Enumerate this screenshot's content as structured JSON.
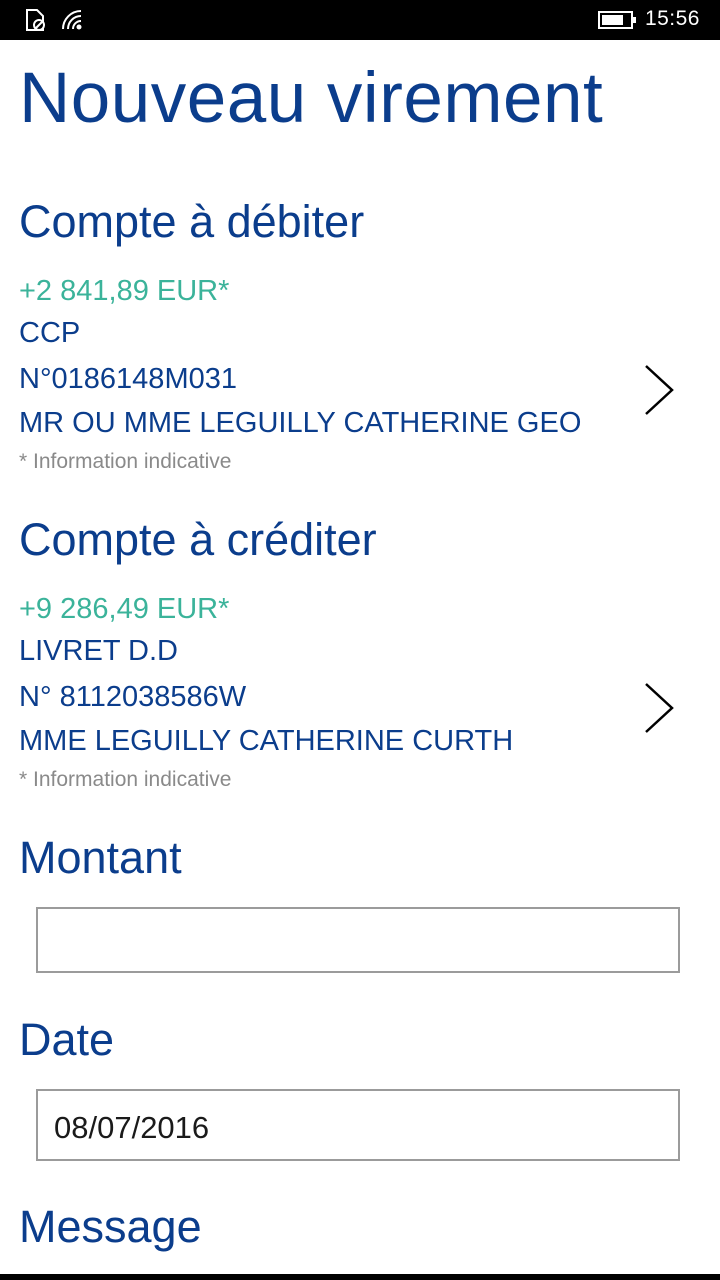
{
  "status_bar": {
    "time": "15:56",
    "icons": [
      "sim-icon",
      "wifi-icon",
      "battery-icon"
    ]
  },
  "page": {
    "title": "Nouveau virement"
  },
  "debit": {
    "heading": "Compte à débiter",
    "balance": "+2 841,89 EUR*",
    "type": "CCP",
    "number": "N°0186148M031",
    "holder": "MR OU MME LEGUILLY CATHERINE GEO",
    "note": "* Information indicative"
  },
  "credit": {
    "heading": "Compte à créditer",
    "balance": "+9 286,49 EUR*",
    "type": "LIVRET D.D",
    "number": "N° 8112038586W",
    "holder": "MME LEGUILLY CATHERINE CURTH",
    "note": "* Information indicative"
  },
  "amount": {
    "label": "Montant",
    "value": ""
  },
  "date": {
    "label": "Date",
    "value": "08/07/2016"
  },
  "message": {
    "label": "Message"
  },
  "colors": {
    "heading": "#0b3d8c",
    "balance": "#3bb39a",
    "note": "#8a8a8a"
  }
}
